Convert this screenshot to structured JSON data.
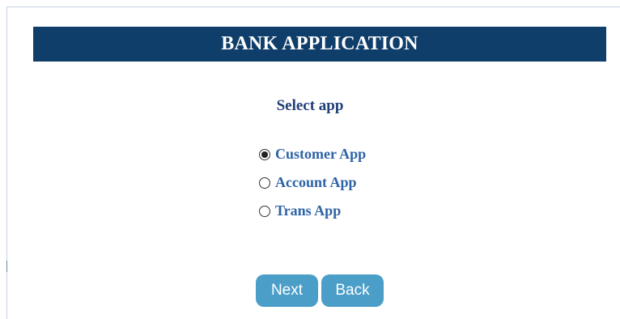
{
  "header": {
    "title": "BANK APPLICATION"
  },
  "main": {
    "section_title": "Select app",
    "options": [
      {
        "label": "Customer App",
        "selected": true
      },
      {
        "label": "Account App",
        "selected": false
      },
      {
        "label": "Trans App",
        "selected": false
      }
    ]
  },
  "buttons": {
    "next": "Next",
    "back": "Back"
  },
  "colors": {
    "header_bg": "#0f3e6a",
    "title_text": "#1f3f77",
    "option_text": "#2f63a6",
    "button_bg": "#4b9ec8"
  }
}
